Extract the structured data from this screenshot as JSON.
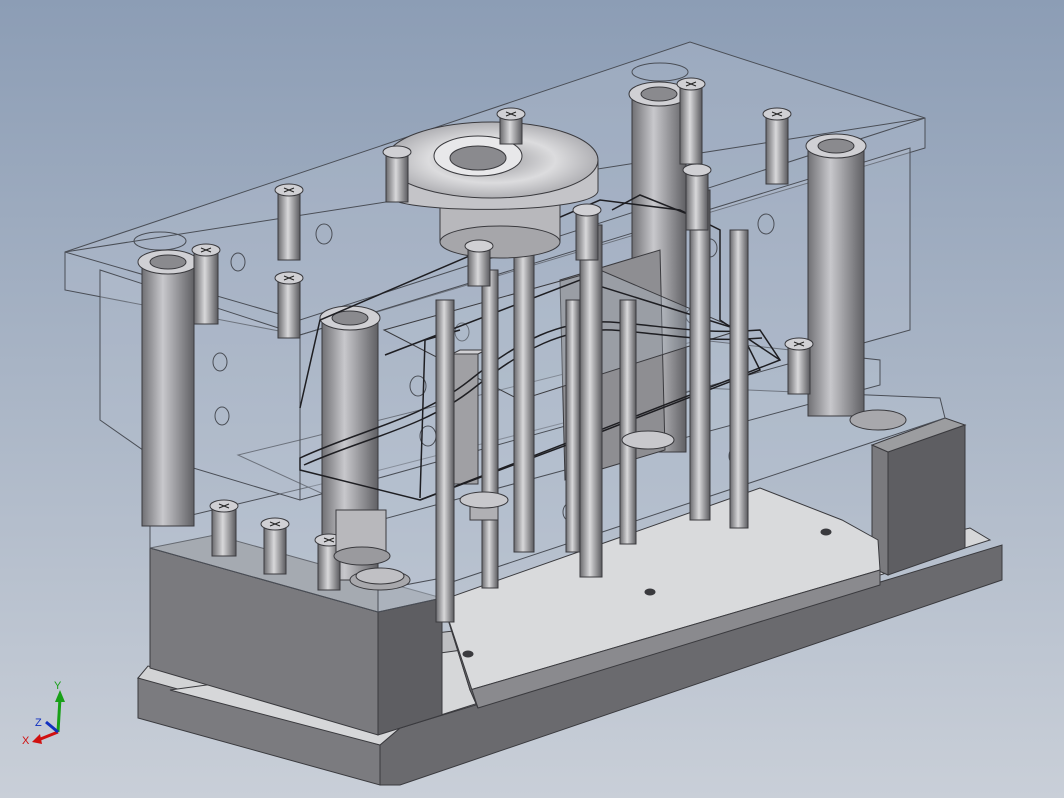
{
  "viewport": {
    "background_top": "#8c9db5",
    "background_bottom": "#c9cfd8"
  },
  "model": {
    "plate_face": "#d6d7d9",
    "plate_side": "#7b7b7f",
    "plate_dark": "#5f5f63",
    "transparent_fill": "#b7c2d0",
    "edge": "#3a3a3e",
    "steel_light": "#e4e4e6",
    "steel_mid": "#a8a8ac",
    "steel_dark": "#6a6a6e"
  },
  "triad": {
    "x_label": "X",
    "y_label": "Y",
    "z_label": "Z",
    "x_color": "#d01010",
    "y_color": "#18a018",
    "z_color": "#1030c0"
  }
}
